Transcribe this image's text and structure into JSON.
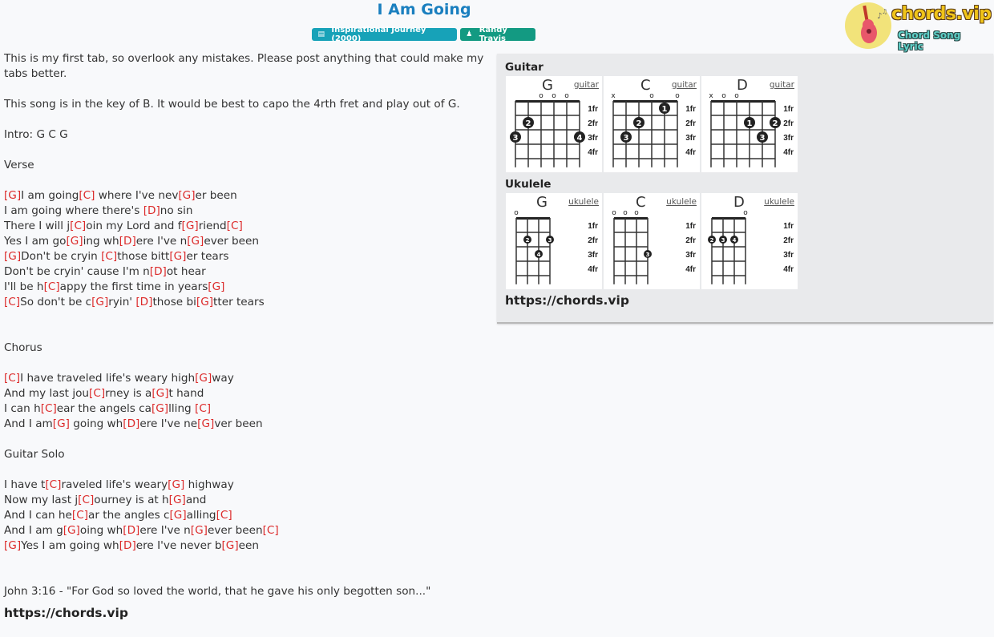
{
  "header": {
    "title": "I Am Going",
    "album_badge": "Inspirational Journey (2000)",
    "artist_badge": "Randy Travis",
    "album_icon": "book-icon",
    "artist_icon": "user-icon"
  },
  "logo": {
    "brand": "chords.vip",
    "tagline": "Chord Song Lyric",
    "icon": "guitar-icon"
  },
  "lyrics": [
    {
      "type": "wrap",
      "parts": [
        {
          "t": "This is my first tab, so overlook any mistakes. Please post anything that could make my tabs better."
        }
      ]
    },
    {
      "type": "blank"
    },
    {
      "type": "line",
      "parts": [
        {
          "t": "This song is in the key of B. It would be best to capo the 4rth fret and play out of G."
        }
      ]
    },
    {
      "type": "blank"
    },
    {
      "type": "line",
      "parts": [
        {
          "t": "Intro: G C G"
        }
      ]
    },
    {
      "type": "blank"
    },
    {
      "type": "line",
      "parts": [
        {
          "t": "Verse"
        }
      ]
    },
    {
      "type": "blank"
    },
    {
      "type": "line",
      "parts": [
        {
          "c": "[G]"
        },
        {
          "t": "I am going"
        },
        {
          "c": "[C]"
        },
        {
          "t": " where I've nev"
        },
        {
          "c": "[G]"
        },
        {
          "t": "er been"
        }
      ]
    },
    {
      "type": "line",
      "parts": [
        {
          "t": "I am going where there's "
        },
        {
          "c": "[D]"
        },
        {
          "t": "no sin"
        }
      ]
    },
    {
      "type": "line",
      "parts": [
        {
          "t": "There I will j"
        },
        {
          "c": "[C]"
        },
        {
          "t": "oin my Lord and f"
        },
        {
          "c": "[G]"
        },
        {
          "t": "riend"
        },
        {
          "c": "[C]"
        }
      ]
    },
    {
      "type": "line",
      "parts": [
        {
          "t": "Yes I am go"
        },
        {
          "c": "[G]"
        },
        {
          "t": "ing wh"
        },
        {
          "c": "[D]"
        },
        {
          "t": "ere I've n"
        },
        {
          "c": "[G]"
        },
        {
          "t": "ever been"
        }
      ]
    },
    {
      "type": "line",
      "parts": [
        {
          "c": "[G]"
        },
        {
          "t": "Don't be cryin "
        },
        {
          "c": "[C]"
        },
        {
          "t": "those bitt"
        },
        {
          "c": "[G]"
        },
        {
          "t": "er tears"
        }
      ]
    },
    {
      "type": "line",
      "parts": [
        {
          "t": "Don't be cryin' cause I'm n"
        },
        {
          "c": "[D]"
        },
        {
          "t": "ot hear"
        }
      ]
    },
    {
      "type": "line",
      "parts": [
        {
          "t": "I'll be h"
        },
        {
          "c": "[C]"
        },
        {
          "t": "appy the first time in years"
        },
        {
          "c": "[G]"
        }
      ]
    },
    {
      "type": "line",
      "parts": [
        {
          "c": "[C]"
        },
        {
          "t": "So don't be c"
        },
        {
          "c": "[G]"
        },
        {
          "t": "ryin' "
        },
        {
          "c": "[D]"
        },
        {
          "t": "those bi"
        },
        {
          "c": "[G]"
        },
        {
          "t": "tter tears"
        }
      ]
    },
    {
      "type": "blank"
    },
    {
      "type": "blank"
    },
    {
      "type": "line",
      "parts": [
        {
          "t": "Chorus"
        }
      ]
    },
    {
      "type": "blank"
    },
    {
      "type": "line",
      "parts": [
        {
          "c": "[C]"
        },
        {
          "t": "I have traveled life's weary high"
        },
        {
          "c": "[G]"
        },
        {
          "t": "way"
        }
      ]
    },
    {
      "type": "line",
      "parts": [
        {
          "t": "And my last jou"
        },
        {
          "c": "[C]"
        },
        {
          "t": "rney is a"
        },
        {
          "c": "[G]"
        },
        {
          "t": "t hand"
        }
      ]
    },
    {
      "type": "line",
      "parts": [
        {
          "t": "I can h"
        },
        {
          "c": "[C]"
        },
        {
          "t": "ear the angels ca"
        },
        {
          "c": "[G]"
        },
        {
          "t": "lling "
        },
        {
          "c": "[C]"
        }
      ]
    },
    {
      "type": "line",
      "parts": [
        {
          "t": "And I am"
        },
        {
          "c": "[G]"
        },
        {
          "t": " going wh"
        },
        {
          "c": "[D]"
        },
        {
          "t": "ere I've ne"
        },
        {
          "c": "[G]"
        },
        {
          "t": "ver been"
        }
      ]
    },
    {
      "type": "blank"
    },
    {
      "type": "line",
      "parts": [
        {
          "t": "Guitar Solo"
        }
      ]
    },
    {
      "type": "blank"
    },
    {
      "type": "line",
      "parts": [
        {
          "t": "I have t"
        },
        {
          "c": "[C]"
        },
        {
          "t": "raveled life's weary"
        },
        {
          "c": "[G]"
        },
        {
          "t": " highway"
        }
      ]
    },
    {
      "type": "line",
      "parts": [
        {
          "t": "Now my last j"
        },
        {
          "c": "[C]"
        },
        {
          "t": "ourney is at h"
        },
        {
          "c": "[G]"
        },
        {
          "t": "and"
        }
      ]
    },
    {
      "type": "line",
      "parts": [
        {
          "t": "And I can he"
        },
        {
          "c": "[C]"
        },
        {
          "t": "ar the angles c"
        },
        {
          "c": "[G]"
        },
        {
          "t": "alling"
        },
        {
          "c": "[C]"
        }
      ]
    },
    {
      "type": "line",
      "parts": [
        {
          "t": "And I am g"
        },
        {
          "c": "[G]"
        },
        {
          "t": "oing wh"
        },
        {
          "c": "[D]"
        },
        {
          "t": "ere I've n"
        },
        {
          "c": "[G]"
        },
        {
          "t": "ever been"
        },
        {
          "c": "[C]"
        }
      ]
    },
    {
      "type": "line",
      "parts": [
        {
          "c": "[G]"
        },
        {
          "t": "Yes I am going wh"
        },
        {
          "c": "[D]"
        },
        {
          "t": "ere I've never b"
        },
        {
          "c": "[G]"
        },
        {
          "t": "een"
        }
      ]
    },
    {
      "type": "blank"
    },
    {
      "type": "blank"
    },
    {
      "type": "line",
      "parts": [
        {
          "t": "John 3:16 - \"For God so loved the world, that he gave his only begotten son...\""
        }
      ]
    }
  ],
  "footer_url": "https://chords.vip",
  "panel": {
    "guitar_heading": "Guitar",
    "ukulele_heading": "Ukulele",
    "url": "https://chords.vip",
    "fret_labels": [
      "1fr",
      "2fr",
      "3fr",
      "4fr"
    ],
    "guitar": [
      {
        "name": "G",
        "link": "guitar",
        "open": [
          "",
          "",
          "o",
          "o",
          "o",
          ""
        ],
        "dots": [
          {
            "s": 1,
            "f": 2,
            "n": "2"
          },
          {
            "s": 0,
            "f": 3,
            "n": "3"
          },
          {
            "s": 5,
            "f": 3,
            "n": "4"
          }
        ]
      },
      {
        "name": "C",
        "link": "guitar",
        "open": [
          "x",
          "",
          "",
          "o",
          "",
          "o"
        ],
        "dots": [
          {
            "s": 4,
            "f": 1,
            "n": "1"
          },
          {
            "s": 2,
            "f": 2,
            "n": "2"
          },
          {
            "s": 1,
            "f": 3,
            "n": "3"
          }
        ]
      },
      {
        "name": "D",
        "link": "guitar",
        "open": [
          "x",
          "o",
          "o",
          "",
          "",
          ""
        ],
        "dots": [
          {
            "s": 3,
            "f": 2,
            "n": "1"
          },
          {
            "s": 5,
            "f": 2,
            "n": "2"
          },
          {
            "s": 4,
            "f": 3,
            "n": "3"
          }
        ]
      }
    ],
    "ukulele": [
      {
        "name": "G",
        "link": "ukulele",
        "open": [
          "o",
          "",
          "",
          ""
        ],
        "dots": [
          {
            "s": 1,
            "f": 2,
            "n": "2"
          },
          {
            "s": 3,
            "f": 2,
            "n": "3"
          },
          {
            "s": 2,
            "f": 3,
            "n": "4"
          }
        ]
      },
      {
        "name": "C",
        "link": "ukulele",
        "open": [
          "o",
          "o",
          "o",
          ""
        ],
        "dots": [
          {
            "s": 3,
            "f": 3,
            "n": "3"
          }
        ]
      },
      {
        "name": "D",
        "link": "ukulele",
        "open": [
          "",
          "",
          "",
          "o"
        ],
        "dots": [
          {
            "s": 0,
            "f": 2,
            "n": "2"
          },
          {
            "s": 1,
            "f": 2,
            "n": "3"
          },
          {
            "s": 2,
            "f": 2,
            "n": "4"
          }
        ]
      }
    ]
  }
}
